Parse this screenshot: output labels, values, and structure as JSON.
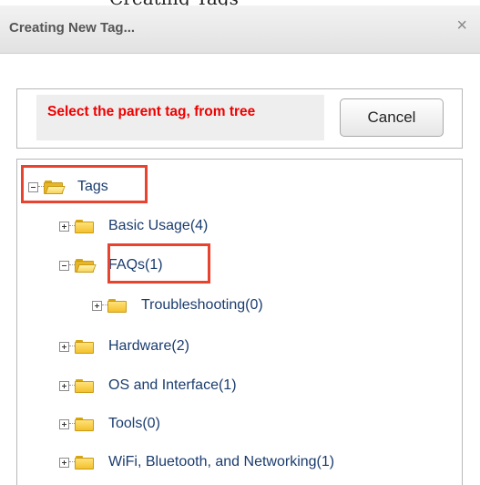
{
  "dialog": {
    "title": "Creating New Tag...",
    "close_glyph": "×"
  },
  "prompt": {
    "text": "Select the parent tag, from tree",
    "cancel_label": "Cancel"
  },
  "tree": {
    "root": {
      "label": "Tags",
      "expanded": true
    },
    "items": [
      {
        "label": "Basic Usage(4)",
        "expanded": false
      },
      {
        "label": "FAQs(1)",
        "expanded": true
      },
      {
        "label": "Troubleshooting(0)",
        "expanded": false
      },
      {
        "label": "Hardware(2)",
        "expanded": false
      },
      {
        "label": "OS and Interface(1)",
        "expanded": false
      },
      {
        "label": "Tools(0)",
        "expanded": false
      },
      {
        "label": "WiFi, Bluetooth, and Networking(1)",
        "expanded": false
      }
    ]
  },
  "colors": {
    "highlight": "#e8432e",
    "prompt_text": "#ee0000",
    "link": "#1a3c6e"
  }
}
